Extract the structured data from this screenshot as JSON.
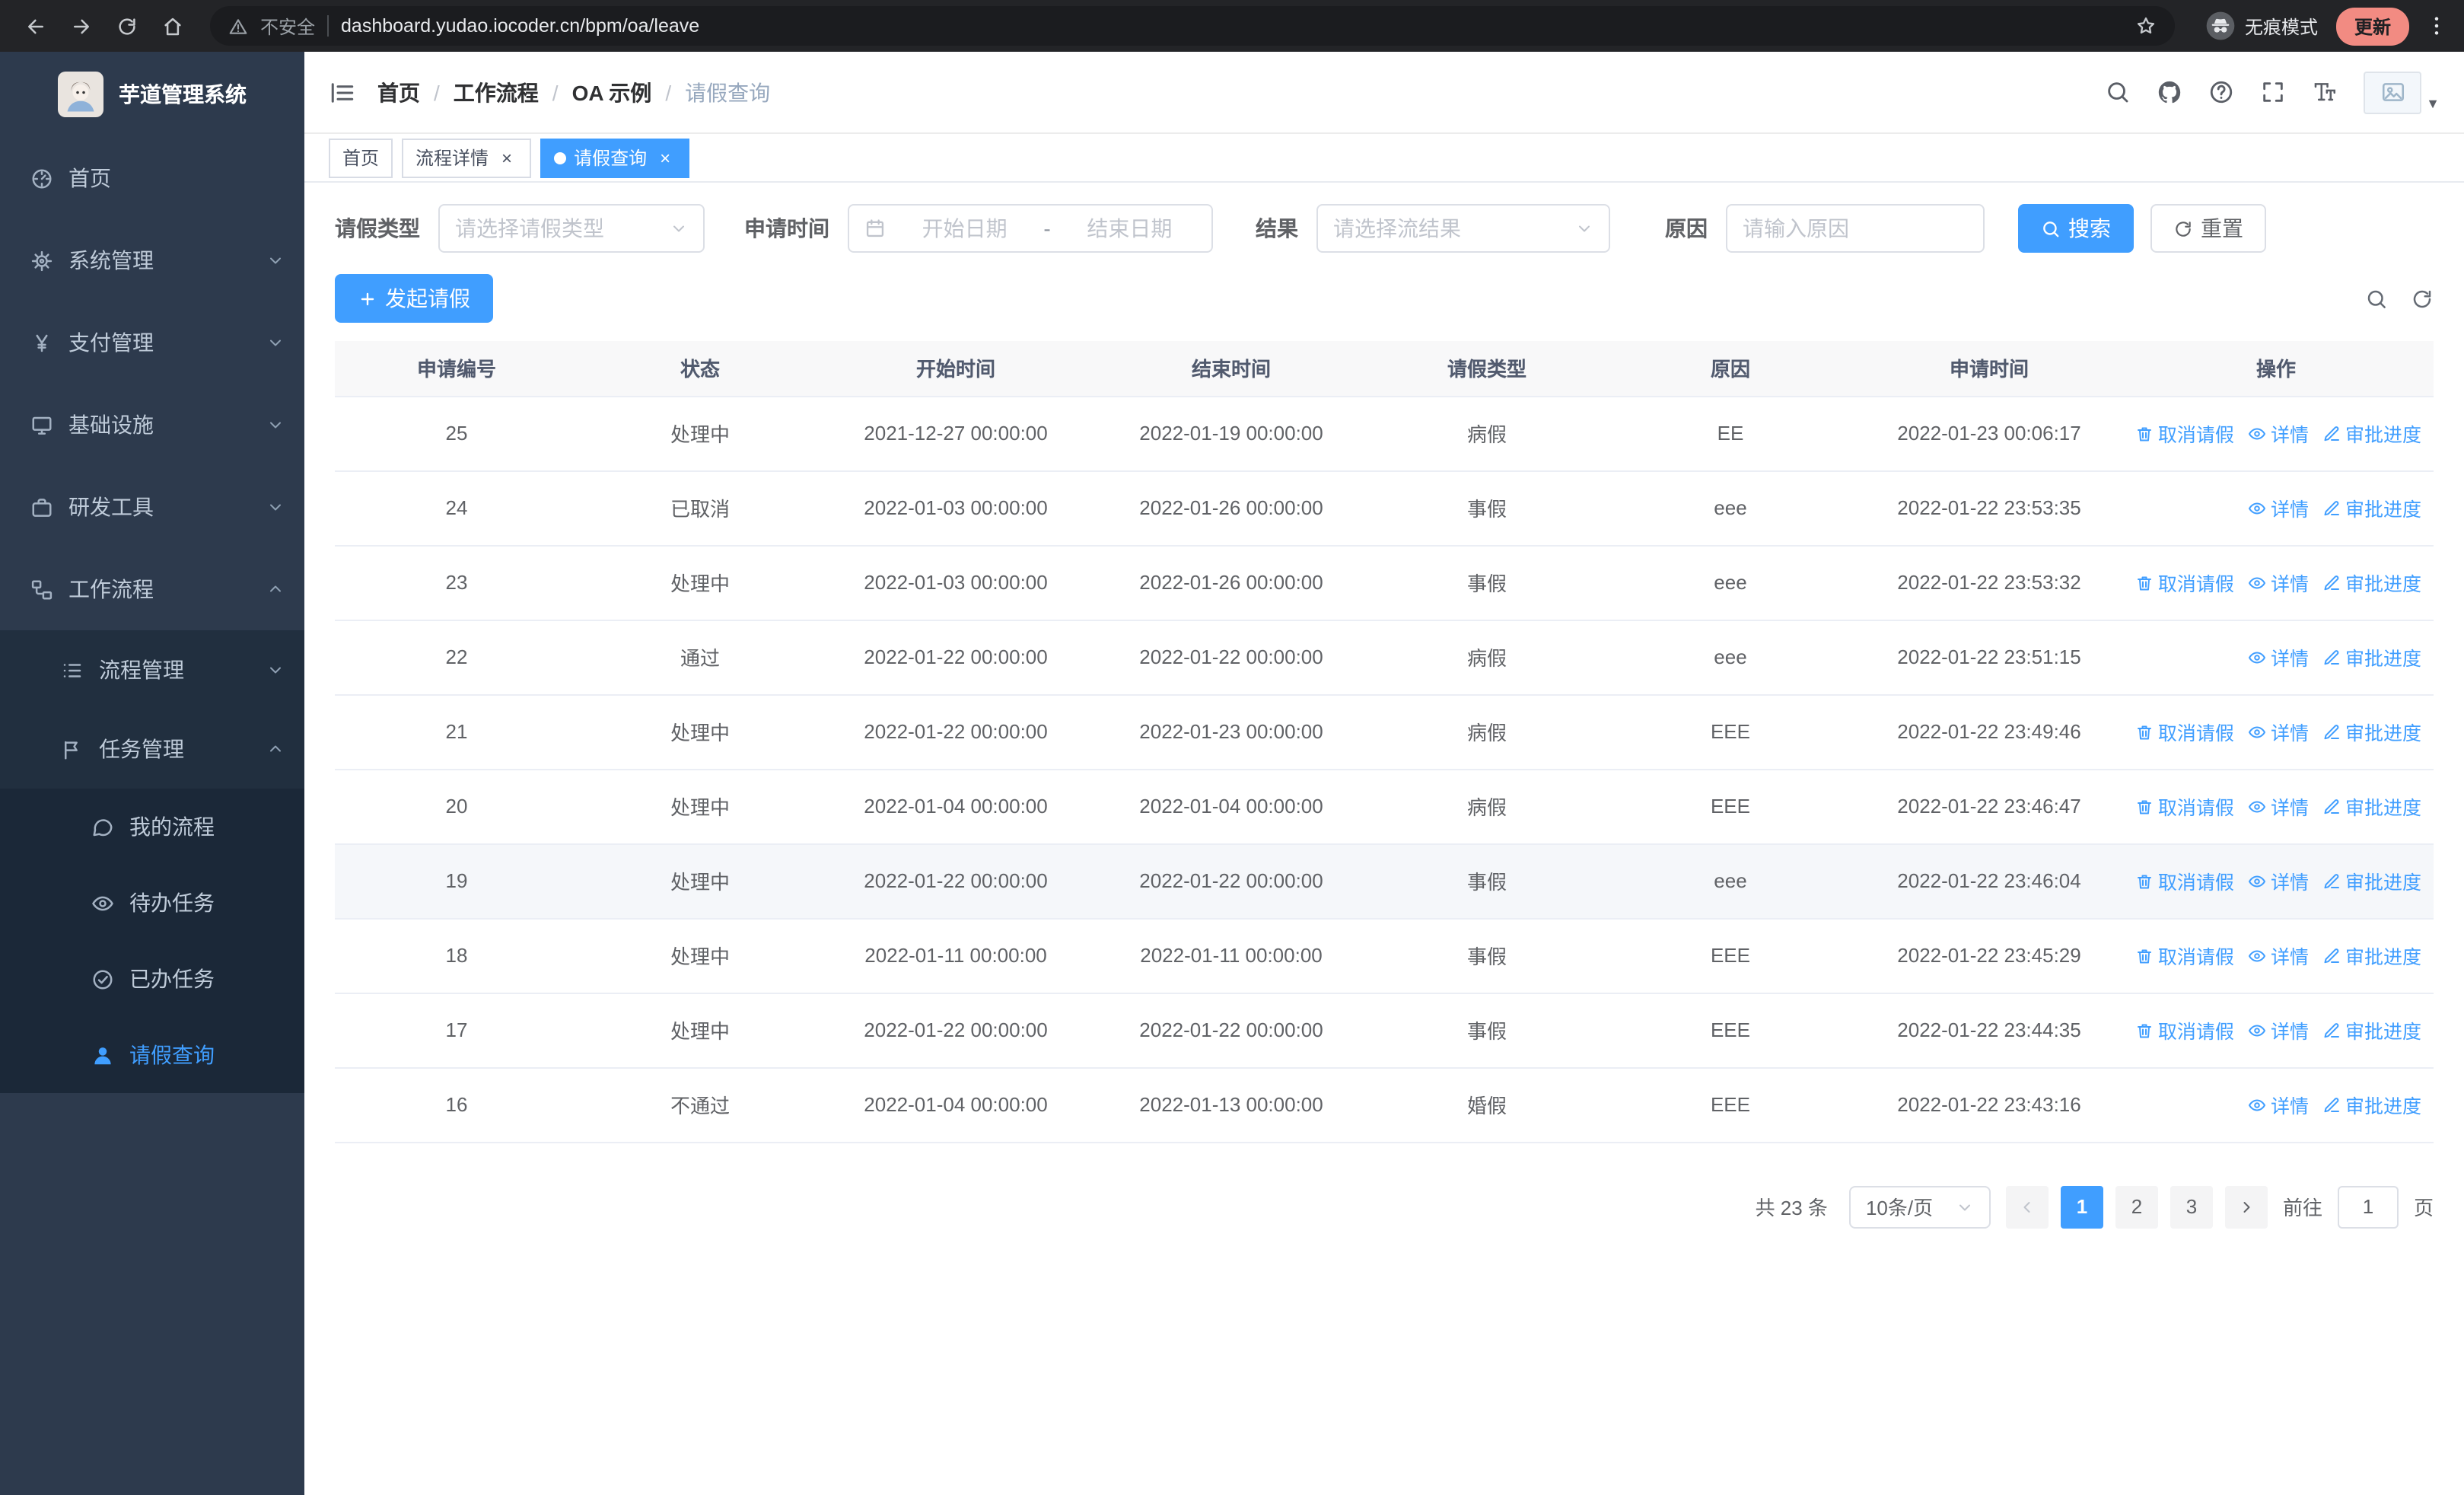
{
  "browser": {
    "warning": "不安全",
    "url": "dashboard.yudao.iocoder.cn/bpm/oa/leave",
    "incognito": "无痕模式",
    "update": "更新"
  },
  "sidebar": {
    "title": "芋道管理系统",
    "menu": [
      {
        "key": "home",
        "label": "首页",
        "icon": "dashboard-icon"
      },
      {
        "key": "system",
        "label": "系统管理",
        "icon": "gear-icon",
        "expandable": true,
        "expanded": false
      },
      {
        "key": "payment",
        "label": "支付管理",
        "icon": "yen-icon",
        "expandable": true,
        "expanded": false
      },
      {
        "key": "infra",
        "label": "基础设施",
        "icon": "monitor-icon",
        "expandable": true,
        "expanded": false
      },
      {
        "key": "devtools",
        "label": "研发工具",
        "icon": "briefcase-icon",
        "expandable": true,
        "expanded": false
      },
      {
        "key": "workflow",
        "label": "工作流程",
        "icon": "workflow-icon",
        "expandable": true,
        "expanded": true,
        "children": [
          {
            "key": "process-mgmt",
            "label": "流程管理",
            "icon": "list-icon",
            "expandable": true,
            "expanded": false
          },
          {
            "key": "task-mgmt",
            "label": "任务管理",
            "icon": "flag-icon",
            "expandable": true,
            "expanded": true,
            "children": [
              {
                "key": "my-process",
                "label": "我的流程",
                "icon": "chat-icon"
              },
              {
                "key": "todo-tasks",
                "label": "待办任务",
                "icon": "eye-icon"
              },
              {
                "key": "done-tasks",
                "label": "已办任务",
                "icon": "check-circle-icon"
              },
              {
                "key": "leave-query",
                "label": "请假查询",
                "icon": "user-icon",
                "active": true
              }
            ]
          }
        ]
      }
    ]
  },
  "header": {
    "breadcrumb": [
      "首页",
      "工作流程",
      "OA 示例",
      "请假查询"
    ]
  },
  "tabs": [
    {
      "key": "home",
      "label": "首页",
      "closable": false,
      "active": false
    },
    {
      "key": "process-detail",
      "label": "流程详情",
      "closable": true,
      "active": false
    },
    {
      "key": "leave-query",
      "label": "请假查询",
      "closable": true,
      "active": true
    }
  ],
  "filters": {
    "leave_type_label": "请假类型",
    "leave_type_placeholder": "请选择请假类型",
    "apply_time_label": "申请时间",
    "start_date_placeholder": "开始日期",
    "range_separator": "-",
    "end_date_placeholder": "结束日期",
    "result_label": "结果",
    "result_placeholder": "请选择流结果",
    "reason_label": "原因",
    "reason_placeholder": "请输入原因",
    "search_button": "搜索",
    "reset_button": "重置"
  },
  "toolbar": {
    "create_button": "发起请假"
  },
  "table": {
    "columns": [
      "申请编号",
      "状态",
      "开始时间",
      "结束时间",
      "请假类型",
      "原因",
      "申请时间",
      "操作"
    ],
    "action_labels": {
      "cancel": "取消请假",
      "detail": "详情",
      "progress": "审批进度"
    },
    "rows": [
      {
        "id": "25",
        "status": "处理中",
        "start": "2021-12-27 00:00:00",
        "end": "2022-01-19 00:00:00",
        "type": "病假",
        "reason": "EE",
        "applied": "2022-01-23 00:06:17",
        "actions": [
          "cancel",
          "detail",
          "progress"
        ],
        "hover": false
      },
      {
        "id": "24",
        "status": "已取消",
        "start": "2022-01-03 00:00:00",
        "end": "2022-01-26 00:00:00",
        "type": "事假",
        "reason": "eee",
        "applied": "2022-01-22 23:53:35",
        "actions": [
          "detail",
          "progress"
        ],
        "hover": false
      },
      {
        "id": "23",
        "status": "处理中",
        "start": "2022-01-03 00:00:00",
        "end": "2022-01-26 00:00:00",
        "type": "事假",
        "reason": "eee",
        "applied": "2022-01-22 23:53:32",
        "actions": [
          "cancel",
          "detail",
          "progress"
        ],
        "hover": false
      },
      {
        "id": "22",
        "status": "通过",
        "start": "2022-01-22 00:00:00",
        "end": "2022-01-22 00:00:00",
        "type": "病假",
        "reason": "eee",
        "applied": "2022-01-22 23:51:15",
        "actions": [
          "detail",
          "progress"
        ],
        "hover": false
      },
      {
        "id": "21",
        "status": "处理中",
        "start": "2022-01-22 00:00:00",
        "end": "2022-01-23 00:00:00",
        "type": "病假",
        "reason": "EEE",
        "applied": "2022-01-22 23:49:46",
        "actions": [
          "cancel",
          "detail",
          "progress"
        ],
        "hover": false
      },
      {
        "id": "20",
        "status": "处理中",
        "start": "2022-01-04 00:00:00",
        "end": "2022-01-04 00:00:00",
        "type": "病假",
        "reason": "EEE",
        "applied": "2022-01-22 23:46:47",
        "actions": [
          "cancel",
          "detail",
          "progress"
        ],
        "hover": false
      },
      {
        "id": "19",
        "status": "处理中",
        "start": "2022-01-22 00:00:00",
        "end": "2022-01-22 00:00:00",
        "type": "事假",
        "reason": "eee",
        "applied": "2022-01-22 23:46:04",
        "actions": [
          "cancel",
          "detail",
          "progress"
        ],
        "hover": true
      },
      {
        "id": "18",
        "status": "处理中",
        "start": "2022-01-11 00:00:00",
        "end": "2022-01-11 00:00:00",
        "type": "事假",
        "reason": "EEE",
        "applied": "2022-01-22 23:45:29",
        "actions": [
          "cancel",
          "detail",
          "progress"
        ],
        "hover": false
      },
      {
        "id": "17",
        "status": "处理中",
        "start": "2022-01-22 00:00:00",
        "end": "2022-01-22 00:00:00",
        "type": "事假",
        "reason": "EEE",
        "applied": "2022-01-22 23:44:35",
        "actions": [
          "cancel",
          "detail",
          "progress"
        ],
        "hover": false
      },
      {
        "id": "16",
        "status": "不通过",
        "start": "2022-01-04 00:00:00",
        "end": "2022-01-13 00:00:00",
        "type": "婚假",
        "reason": "EEE",
        "applied": "2022-01-22 23:43:16",
        "actions": [
          "detail",
          "progress"
        ],
        "hover": false
      }
    ]
  },
  "pagination": {
    "total": "共 23 条",
    "page_size": "10条/页",
    "pages": [
      "1",
      "2",
      "3"
    ],
    "current": "1",
    "goto_label": "前往",
    "goto_value": "1",
    "goto_suffix": "页"
  },
  "colors": {
    "accent": "#409EFF",
    "sidebar_bg": "#2D3A4D",
    "submenu_bg": "#212F3F",
    "update_chip": "#F28B82",
    "table_border": "#EBEEF5"
  }
}
